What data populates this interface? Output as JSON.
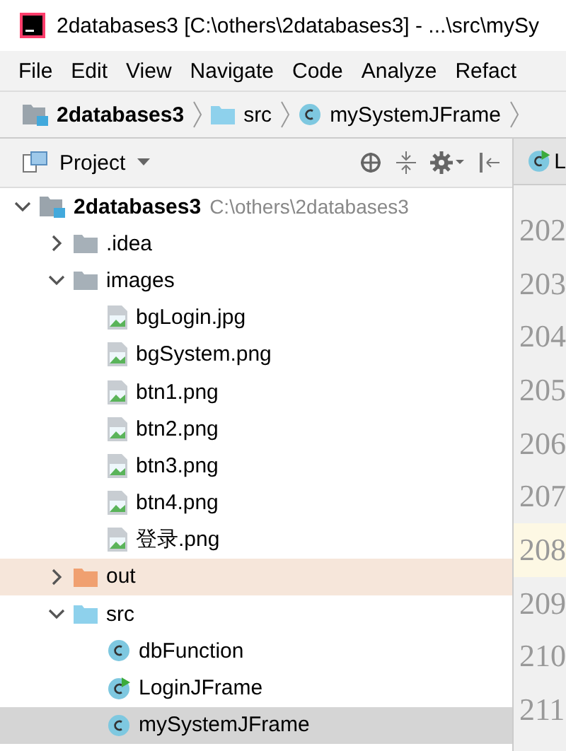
{
  "window": {
    "title": "2databases3 [C:\\others\\2databases3] - ...\\src\\mySy"
  },
  "menu": [
    "File",
    "Edit",
    "View",
    "Navigate",
    "Code",
    "Analyze",
    "Refact"
  ],
  "breadcrumb": [
    {
      "label": "2databases3",
      "kind": "project"
    },
    {
      "label": "src",
      "kind": "folder"
    },
    {
      "label": "mySystemJFrame",
      "kind": "class"
    }
  ],
  "project_panel": {
    "title": "Project"
  },
  "tree": [
    {
      "name": "2databases3",
      "path": "C:\\others\\2databases3",
      "kind": "project",
      "expanded": true,
      "selected": false,
      "children": [
        {
          "name": ".idea",
          "kind": "folder",
          "expanded": false,
          "selected": false
        },
        {
          "name": "images",
          "kind": "folder",
          "expanded": true,
          "selected": false,
          "children": [
            {
              "name": "bgLogin.jpg",
              "kind": "image",
              "selected": false
            },
            {
              "name": "bgSystem.png",
              "kind": "image",
              "selected": false
            },
            {
              "name": "btn1.png",
              "kind": "image",
              "selected": false
            },
            {
              "name": "btn2.png",
              "kind": "image",
              "selected": false
            },
            {
              "name": "btn3.png",
              "kind": "image",
              "selected": false
            },
            {
              "name": "btn4.png",
              "kind": "image",
              "selected": false
            },
            {
              "name": "登录.png",
              "kind": "image",
              "selected": false
            }
          ]
        },
        {
          "name": "out",
          "kind": "excluded",
          "expanded": false,
          "selected": false
        },
        {
          "name": "src",
          "kind": "source",
          "expanded": true,
          "selected": false,
          "children": [
            {
              "name": "dbFunction",
              "kind": "class",
              "selected": false
            },
            {
              "name": "LoginJFrame",
              "kind": "runnable",
              "selected": false
            },
            {
              "name": "mySystemJFrame",
              "kind": "class",
              "selected": true
            }
          ]
        }
      ]
    }
  ],
  "editor": {
    "tab": {
      "label": "L"
    },
    "lines": [
      {
        "number": "202",
        "current": false
      },
      {
        "number": "203",
        "current": false
      },
      {
        "number": "204",
        "current": false
      },
      {
        "number": "205",
        "current": false
      },
      {
        "number": "206",
        "current": false
      },
      {
        "number": "207",
        "current": false
      },
      {
        "number": "208",
        "current": true
      },
      {
        "number": "209",
        "current": false
      },
      {
        "number": "210",
        "current": false
      },
      {
        "number": "211",
        "current": false
      }
    ]
  }
}
